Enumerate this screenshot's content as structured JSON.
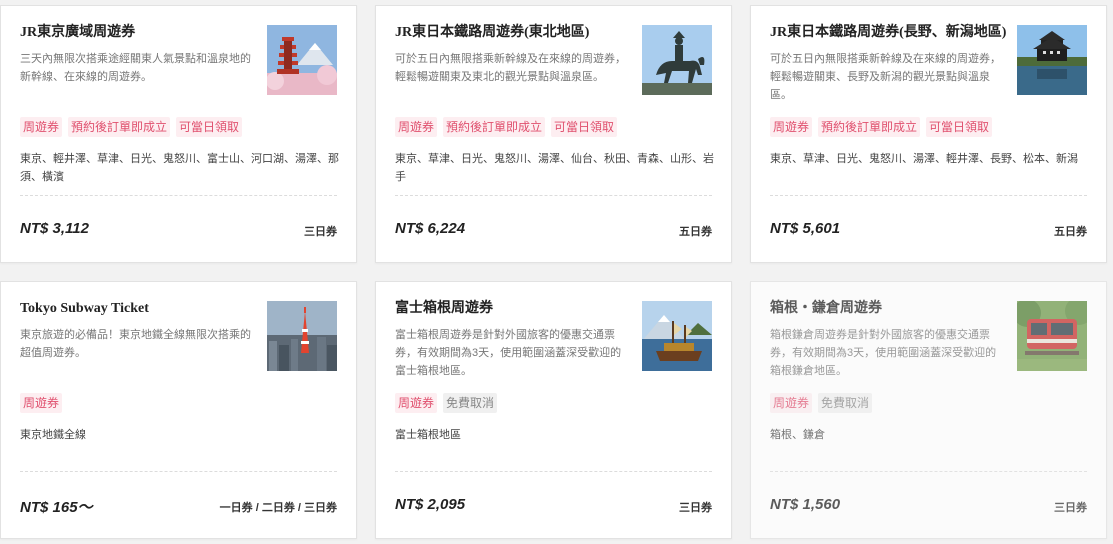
{
  "cards": [
    {
      "title": "JR東京廣域周遊券",
      "description": "三天內無限次搭乘途經關東人氣景點和溫泉地的新幹線、在來線的周遊券。",
      "image": "chureito-pagoda-fuji",
      "tags": [
        "周遊券",
        "預約後訂單即成立",
        "可當日領取"
      ],
      "stations": "東京、輕井澤、草津、日光、鬼怒川、富士山、河口湖、湯澤、那須、橫濱",
      "price": "NT$ 3,112",
      "duration": "三日券"
    },
    {
      "title": "JR東日本鐵路周遊券(東北地區)",
      "description": "可於五日內無限搭乘新幹線及在來線的周遊券，輕鬆暢遊關東及東北的觀光景點與溫泉區。",
      "image": "date-masamune-statue",
      "tags": [
        "周遊券",
        "預約後訂單即成立",
        "可當日領取"
      ],
      "stations": "東京、草津、日光、鬼怒川、湯澤、仙台、秋田、青森、山形、岩手",
      "price": "NT$ 6,224",
      "duration": "五日券"
    },
    {
      "title": "JR東日本鐵路周遊券(長野、新潟地區)",
      "description": "可於五日內無限搭乘新幹線及在來線的周遊券，輕鬆暢遊關東、長野及新潟的觀光景點與溫泉區。",
      "image": "matsumoto-castle",
      "tags": [
        "周遊券",
        "預約後訂單即成立",
        "可當日領取"
      ],
      "stations": "東京、草津、日光、鬼怒川、湯澤、輕井澤、長野、松本、新潟",
      "price": "NT$ 5,601",
      "duration": "五日券"
    },
    {
      "title": "Tokyo Subway Ticket",
      "description": "東京旅遊的必備品！東京地鐵全線無限次搭乘的超值周遊券。",
      "image": "tokyo-tower-skyline",
      "tags": [
        "周遊券"
      ],
      "stations": "東京地鐵全線",
      "price": "NT$ 165～",
      "duration": "一日券 / 二日券 / 三日券"
    },
    {
      "title": "富士箱根周遊券",
      "description": "富士箱根周遊券是針對外國旅客的優惠交通票券，有效期間為3天，使用範圍涵蓋深受歡迎的富士箱根地區。",
      "image": "hakone-pirate-ship",
      "tags": [
        "周遊券",
        "免費取消"
      ],
      "stations": "富士箱根地區",
      "price": "NT$ 2,095",
      "duration": "三日券"
    },
    {
      "title": "箱根・鎌倉周遊券",
      "description": "箱根鎌倉周遊券是針對外國旅客的優惠交通票券，有效期間為3天，使用範圍涵蓋深受歡迎的箱根鎌倉地區。",
      "image": "hakone-tozan-train",
      "tags": [
        "周遊券",
        "免費取消"
      ],
      "stations": "箱根、鎌倉",
      "price": "NT$ 1,560",
      "duration": "三日券"
    }
  ]
}
